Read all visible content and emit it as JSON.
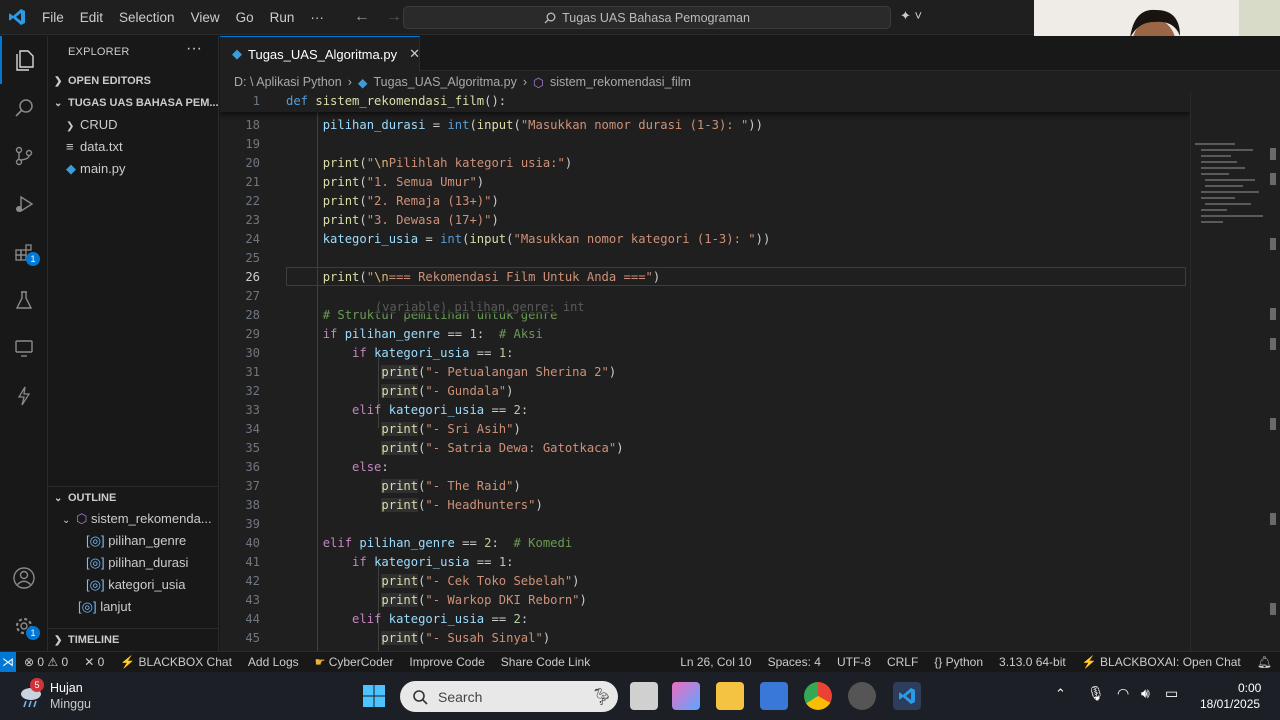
{
  "titlebar": {
    "menus": [
      "File",
      "Edit",
      "Selection",
      "View",
      "Go",
      "Run",
      "···"
    ],
    "search_text": "Tugas UAS Bahasa Pemograman"
  },
  "activity_badges": {
    "extensions": "1",
    "manage": "1"
  },
  "sidebar": {
    "title": "EXPLORER",
    "open_editors": "OPEN EDITORS",
    "project": "TUGAS UAS BAHASA PEM...",
    "items": [
      "CRUD",
      "data.txt",
      "main.py"
    ],
    "outline_title": "OUTLINE",
    "outline_root": "sistem_rekomenda...",
    "outline_items": [
      "pilihan_genre",
      "pilihan_durasi",
      "kategori_usia"
    ],
    "outline_lanjut": "lanjut",
    "timeline": "TIMELINE"
  },
  "tab": {
    "label": "Tugas_UAS_Algoritma.py"
  },
  "breadcrumb": [
    "D: \\ Aplikasi Python",
    "Tugas_UAS_Algoritma.py",
    "sistem_rekomendasi_film"
  ],
  "editor": {
    "sticky_line": "1",
    "line_numbers": [
      "18",
      "19",
      "20",
      "21",
      "22",
      "23",
      "24",
      "25",
      "26",
      "27",
      "28",
      "29",
      "30",
      "31",
      "32",
      "33",
      "34",
      "35",
      "36",
      "37",
      "38",
      "39",
      "40",
      "41",
      "42",
      "43",
      "44",
      "45"
    ],
    "current_line": "26",
    "hover_hint": "(variable) pilihan_genre: int"
  },
  "statusbar": {
    "problems": "⊗ 0 ⚠ 0",
    "ports": "✕ 0",
    "blackbox": "BLACKBOX Chat",
    "add_logs": "Add Logs",
    "cybercoder": "CyberCoder",
    "improve": "Improve Code",
    "share": "Share Code Link",
    "position": "Ln 26, Col 10",
    "spaces": "Spaces: 4",
    "encoding": "UTF-8",
    "eol": "CRLF",
    "language": "Python",
    "interpreter": "3.13.0 64-bit",
    "blackboxai": "BLACKBOXAI: Open Chat"
  },
  "taskbar": {
    "weather_badge": "5",
    "weather": "Hujan",
    "weather_sub": "Minggu",
    "search_placeholder": "Search",
    "time": "0:00",
    "date": "18/01/2025"
  }
}
